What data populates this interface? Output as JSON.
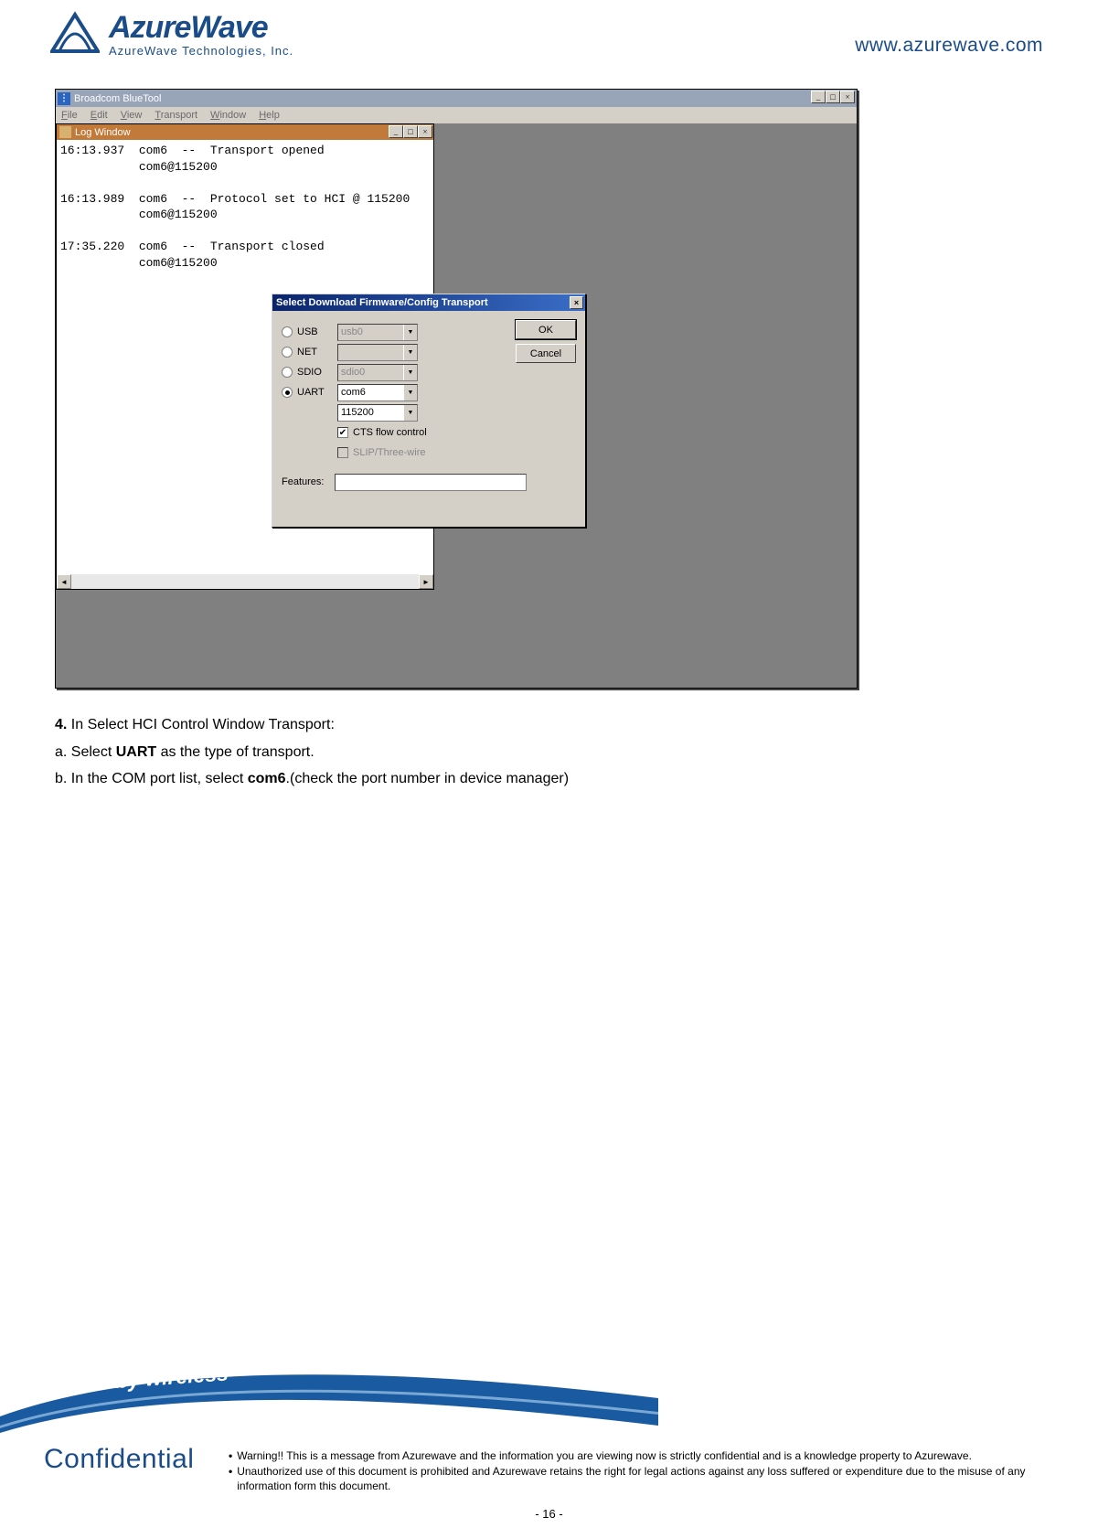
{
  "header": {
    "brand_main": "AzureWave",
    "brand_sub": "AzureWave  Technologies,  Inc.",
    "url": "www.azurewave.com"
  },
  "screenshot": {
    "main_title": "Broadcom BlueTool",
    "menu": {
      "file": "File",
      "edit": "Edit",
      "view": "View",
      "transport": "Transport",
      "window": "Window",
      "help": "Help"
    },
    "logwin_title": "Log Window",
    "log_text": "16:13.937  com6  --  Transport opened\n           com6@115200\n\n16:13.989  com6  --  Protocol set to HCI @ 115200\n           com6@115200\n\n17:35.220  com6  --  Transport closed\n           com6@115200",
    "dialog": {
      "title": "Select Download Firmware/Config Transport",
      "opts": {
        "usb": "USB",
        "net": "NET",
        "sdio": "SDIO",
        "uart": "UART"
      },
      "vals": {
        "usb": "usb0",
        "sdio": "sdio0",
        "uart_port": "com6",
        "uart_baud": "115200"
      },
      "cts": "CTS flow control",
      "slip": "SLIP/Three-wire",
      "features_label": "Features:",
      "ok": "OK",
      "cancel": "Cancel"
    }
  },
  "instructions": {
    "line1_pre": "4.",
    "line1": " In Select HCI Control Window Transport:",
    "line2_pre": "a. Select ",
    "line2_b": "UART",
    "line2_post": " as the type of transport.",
    "line3_pre": "b. In the COM port list, select ",
    "line3_b": "com6",
    "line3_post": ".(check the port number in device manager)"
  },
  "footer": {
    "tagline": "Inspired by wireless",
    "confidential": "Confidential",
    "warn1": "Warning!! This is a message from Azurewave and the information you are viewing now is strictly confidential and is a knowledge property to Azurewave.",
    "warn2": "Unauthorized use of this document is prohibited and Azurewave retains the right for legal actions against any loss suffered or expenditure due to the misuse of any information form this document.",
    "pagenum": "- 16 -"
  }
}
